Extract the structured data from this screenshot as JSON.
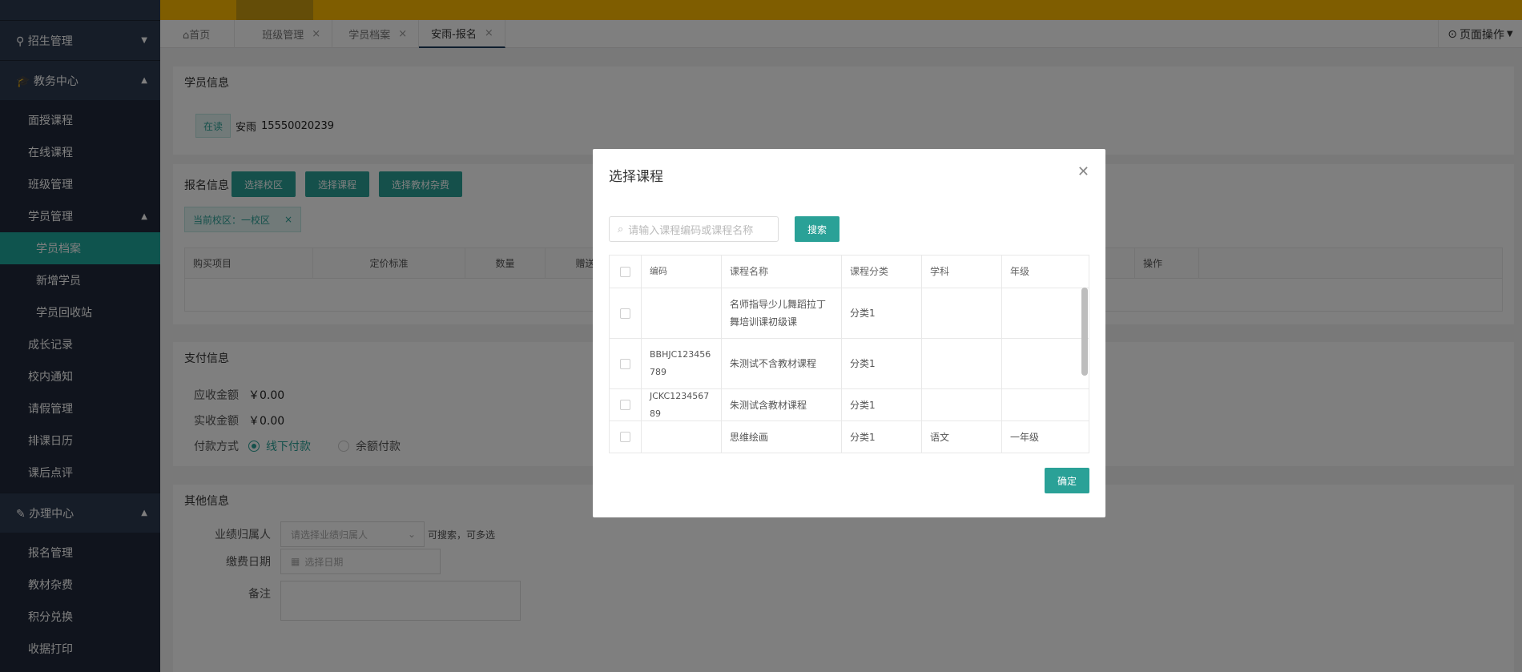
{
  "sidebar": {
    "groups": [
      {
        "label": "招生管理",
        "icon": "user-icon",
        "expanded": false
      },
      {
        "label": "教务中心",
        "icon": "graduation-cap-icon",
        "expanded": true
      },
      {
        "label": "办理中心",
        "icon": "edit-icon",
        "expanded": true
      }
    ],
    "edu_items": [
      "面授课程",
      "在线课程",
      "班级管理"
    ],
    "student_mgmt": "学员管理",
    "student_sub": [
      "学员档案",
      "新增学员",
      "学员回收站"
    ],
    "edu_items2": [
      "成长记录",
      "校内通知",
      "请假管理",
      "排课日历",
      "课后点评"
    ],
    "handle_items": [
      "报名管理",
      "教材杂费",
      "积分兑换",
      "收据打印"
    ]
  },
  "tabs": [
    {
      "label": "首页",
      "icon": "home-icon",
      "closable": false
    },
    {
      "label": "班级管理",
      "closable": true
    },
    {
      "label": "学员档案",
      "closable": true
    },
    {
      "label": "安雨-报名",
      "closable": true,
      "active": true
    }
  ],
  "page_ops": "页面操作",
  "student_info": {
    "title": "学员信息",
    "status": "在读",
    "name": "安雨",
    "phone": "15550020239"
  },
  "signup": {
    "title": "报名信息",
    "btn_campus": "选择校区",
    "btn_course": "选择课程",
    "btn_material": "选择教材杂费",
    "campus_tag": "当前校区：一校区",
    "columns": [
      "购买项目",
      "定价标准",
      "数量",
      "赠送",
      "操作"
    ]
  },
  "payment": {
    "title": "支付信息",
    "due_label": "应收金额",
    "due_value": "￥0.00",
    "paid_label": "实收金额",
    "paid_value": "￥0.00",
    "method_label": "付款方式",
    "method_offline": "线下付款",
    "method_balance": "余额付款"
  },
  "other": {
    "title": "其他信息",
    "owner_label": "业绩归属人",
    "owner_placeholder": "请选择业绩归属人",
    "owner_hint": "可搜索，可多选",
    "date_label": "缴费日期",
    "date_placeholder": "选择日期",
    "remark_label": "备注"
  },
  "modal": {
    "title": "选择课程",
    "search_placeholder": "请输入课程编码或课程名称",
    "search_btn": "搜索",
    "ok_btn": "确定",
    "columns": [
      "编码",
      "课程名称",
      "课程分类",
      "学科",
      "年级"
    ],
    "rows": [
      {
        "code": "",
        "name": "名师指导少儿舞蹈拉丁舞培训课初级课",
        "category": "分类1",
        "subject": "",
        "grade": ""
      },
      {
        "code": "BBHJC123456789",
        "name": "朱测试不含教材课程",
        "category": "分类1",
        "subject": "",
        "grade": ""
      },
      {
        "code": "JCKC123456789",
        "name": "朱测试含教材课程",
        "category": "分类1",
        "subject": "",
        "grade": ""
      },
      {
        "code": "",
        "name": "思维绘画",
        "category": "分类1",
        "subject": "语文",
        "grade": "一年级"
      }
    ]
  },
  "colors": {
    "accent": "#2aa197",
    "topbar": "#ffba00",
    "sidebar": "#20293a"
  }
}
